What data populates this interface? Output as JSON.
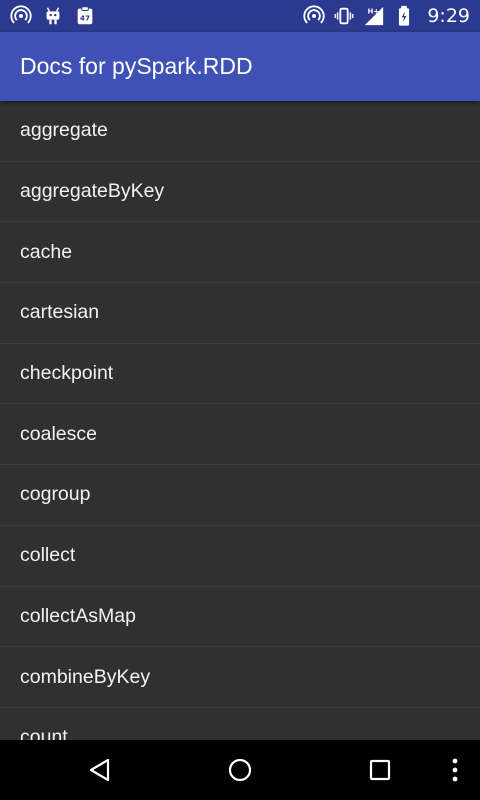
{
  "status_bar": {
    "time": "9:29",
    "left_icons": [
      "hotspot-icon",
      "android-debug-icon",
      "clipboard-badge-icon"
    ],
    "right_icons": [
      "hotspot-icon",
      "vibrate-icon",
      "signal-icon",
      "battery-icon"
    ],
    "notification_badge": "47",
    "network_type": "H+"
  },
  "app_bar": {
    "title": "Docs for pySpark.RDD"
  },
  "list": {
    "items": [
      {
        "label": "aggregate"
      },
      {
        "label": "aggregateByKey"
      },
      {
        "label": "cache"
      },
      {
        "label": "cartesian"
      },
      {
        "label": "checkpoint"
      },
      {
        "label": "coalesce"
      },
      {
        "label": "cogroup"
      },
      {
        "label": "collect"
      },
      {
        "label": "collectAsMap"
      },
      {
        "label": "combineByKey"
      },
      {
        "label": "count"
      }
    ]
  },
  "nav_bar": {
    "buttons": [
      "back-icon",
      "home-icon",
      "recents-icon",
      "overflow-menu-icon"
    ]
  },
  "colors": {
    "status_bar": "#2b3a8f",
    "app_bar": "#3f51b5",
    "list_background": "#303030",
    "divider": "#3d3d3d",
    "text": "#f2f2f2"
  }
}
